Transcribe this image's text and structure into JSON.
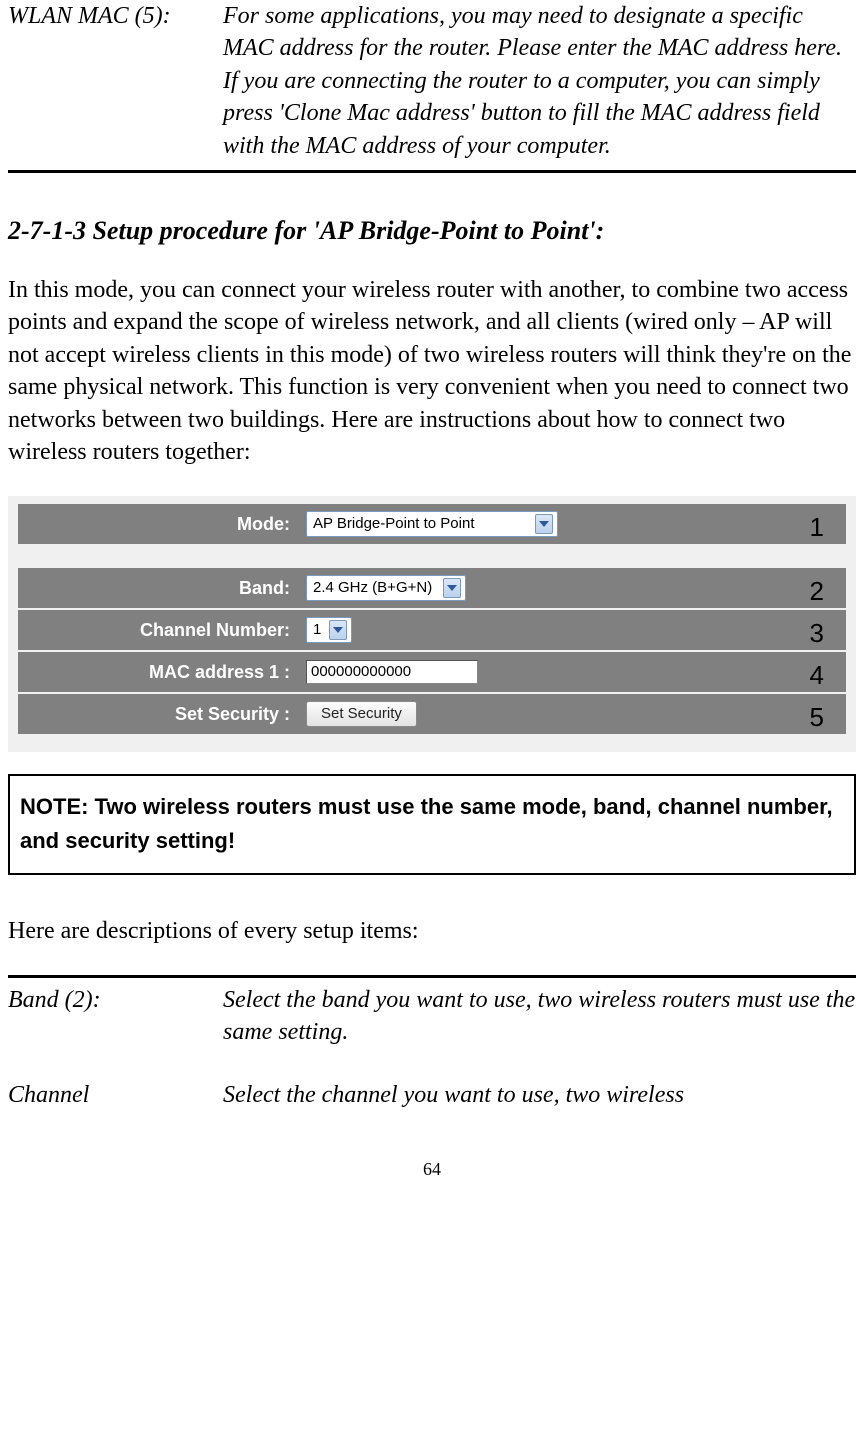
{
  "top_def": {
    "label": "WLAN MAC (5):",
    "desc": "For some applications, you may need to designate a specific MAC address for the router. Please enter the MAC address here. If you are connecting the router to a computer, you can simply press 'Clone Mac address' button to fill the MAC address field with the MAC address of your computer."
  },
  "section_title": "2-7-1-3 Setup procedure for 'AP Bridge-Point to Point':",
  "intro_para": "In this mode, you can connect your wireless router with another, to combine two access points and expand the scope of wireless network, and all clients (wired only – AP will not accept wireless clients in this mode) of two wireless routers will think they're on the same physical network. This function is very convenient when you need to connect two networks between two buildings. Here are instructions about how to connect two wireless routers together:",
  "config": {
    "mode": {
      "label": "Mode:",
      "value": "AP Bridge-Point to Point",
      "callout": "1"
    },
    "band": {
      "label": "Band:",
      "value": "2.4 GHz (B+G+N)",
      "callout": "2"
    },
    "channel": {
      "label": "Channel Number:",
      "value": "1",
      "callout": "3"
    },
    "mac1": {
      "label": "MAC address 1 :",
      "value": "000000000000",
      "callout": "4"
    },
    "security": {
      "label": "Set Security :",
      "button": "Set Security",
      "callout": "5"
    }
  },
  "note_text": "NOTE: Two wireless routers must use the same mode, band, channel number, and security setting!",
  "desc_intro": "Here are descriptions of every setup items:",
  "defs": {
    "band": {
      "label": "Band (2):",
      "desc": "Select the band you want to use, two wireless routers must use the same setting."
    },
    "channel": {
      "label": "Channel",
      "desc": "Select the channel you want to use, two wireless"
    }
  },
  "page_number": "64"
}
